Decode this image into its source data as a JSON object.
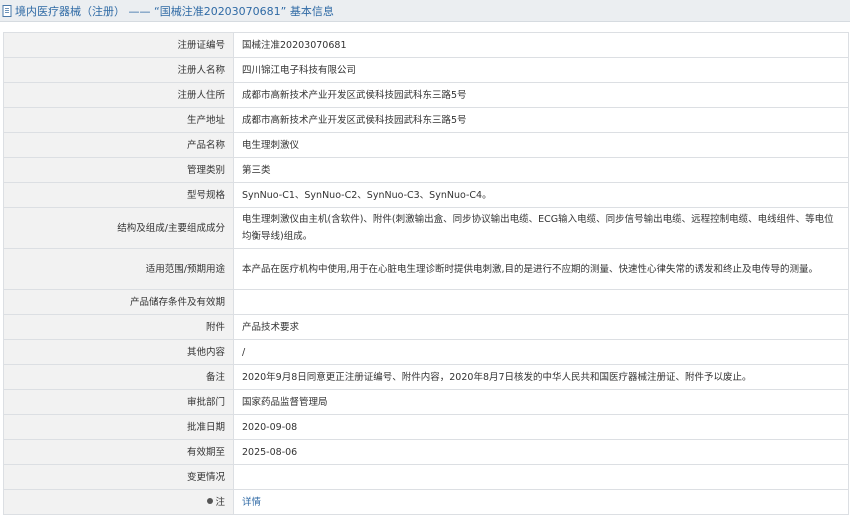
{
  "header": {
    "title": "境内医疗器械（注册） —— “国械注准20203070681” 基本信息"
  },
  "rows": [
    {
      "label": "注册证编号",
      "value": "国械注准20203070681"
    },
    {
      "label": "注册人名称",
      "value": "四川锦江电子科技有限公司"
    },
    {
      "label": "注册人住所",
      "value": "成都市高新技术产业开发区武侯科技园武科东三路5号"
    },
    {
      "label": "生产地址",
      "value": "成都市高新技术产业开发区武侯科技园武科东三路5号"
    },
    {
      "label": "产品名称",
      "value": "电生理刺激仪"
    },
    {
      "label": "管理类别",
      "value": "第三类"
    },
    {
      "label": "型号规格",
      "value": "SynNuo-C1、SynNuo-C2、SynNuo-C3、SynNuo-C4。"
    },
    {
      "label": "结构及组成/主要组成成分",
      "value": "电生理刺激仪由主机(含软件)、附件(刺激输出盒、同步协议输出电缆、ECG输入电缆、同步信号输出电缆、远程控制电缆、电线组件、等电位均衡导线)组成。"
    },
    {
      "label": "适用范围/预期用途",
      "value": "本产品在医疗机构中使用,用于在心脏电生理诊断时提供电刺激,目的是进行不应期的测量、快速性心律失常的诱发和终止及电传导的测量。"
    },
    {
      "label": "产品储存条件及有效期",
      "value": ""
    },
    {
      "label": "附件",
      "value": "产品技术要求"
    },
    {
      "label": "其他内容",
      "value": "/"
    },
    {
      "label": "备注",
      "value": "2020年9月8日同意更正注册证编号、附件内容，2020年8月7日核发的中华人民共和国医疗器械注册证、附件予以废止。"
    },
    {
      "label": "审批部门",
      "value": "国家药品监督管理局"
    },
    {
      "label": "批准日期",
      "value": "2020-09-08"
    },
    {
      "label": "有效期至",
      "value": "2025-08-06"
    },
    {
      "label": "变更情况",
      "value": ""
    }
  ],
  "note_row": {
    "label": "注",
    "link": "详情"
  }
}
